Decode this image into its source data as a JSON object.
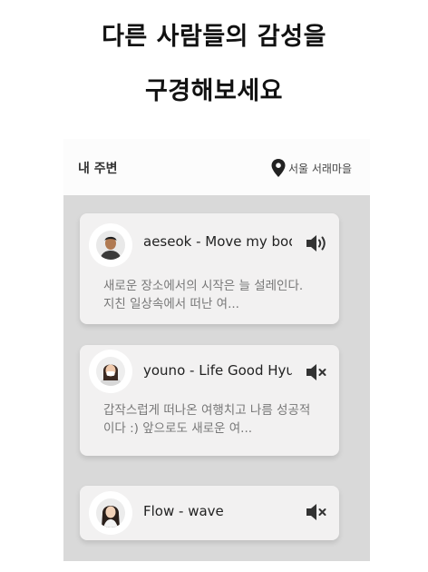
{
  "headline": {
    "line1": "다른 사람들의 감성을",
    "line2": "구경해보세요"
  },
  "topbar": {
    "title": "내 주변",
    "location": "서울 서래마을",
    "location_icon": "map-pin-icon"
  },
  "posts": [
    {
      "track": "aeseok - Move my body",
      "description": "새로운 장소에서의 시작은 늘 설레인다. 지친 일상속에서 떠난 여...",
      "sound": "on",
      "sound_icon": "speaker-on-icon"
    },
    {
      "track": "youno - Life Good Hyun",
      "description": "갑작스럽게 떠나온 여행치고 나름 성공적이다 :) 앞으로도 새로운 여...",
      "sound": "muted",
      "sound_icon": "speaker-muted-icon"
    },
    {
      "track": "Flow - wave",
      "sound": "muted",
      "sound_icon": "speaker-muted-icon"
    }
  ],
  "colors": {
    "feed_background": "#d9d9d9",
    "card_background": "#f2f1f1",
    "headline": "#111111",
    "description": "#777777"
  }
}
